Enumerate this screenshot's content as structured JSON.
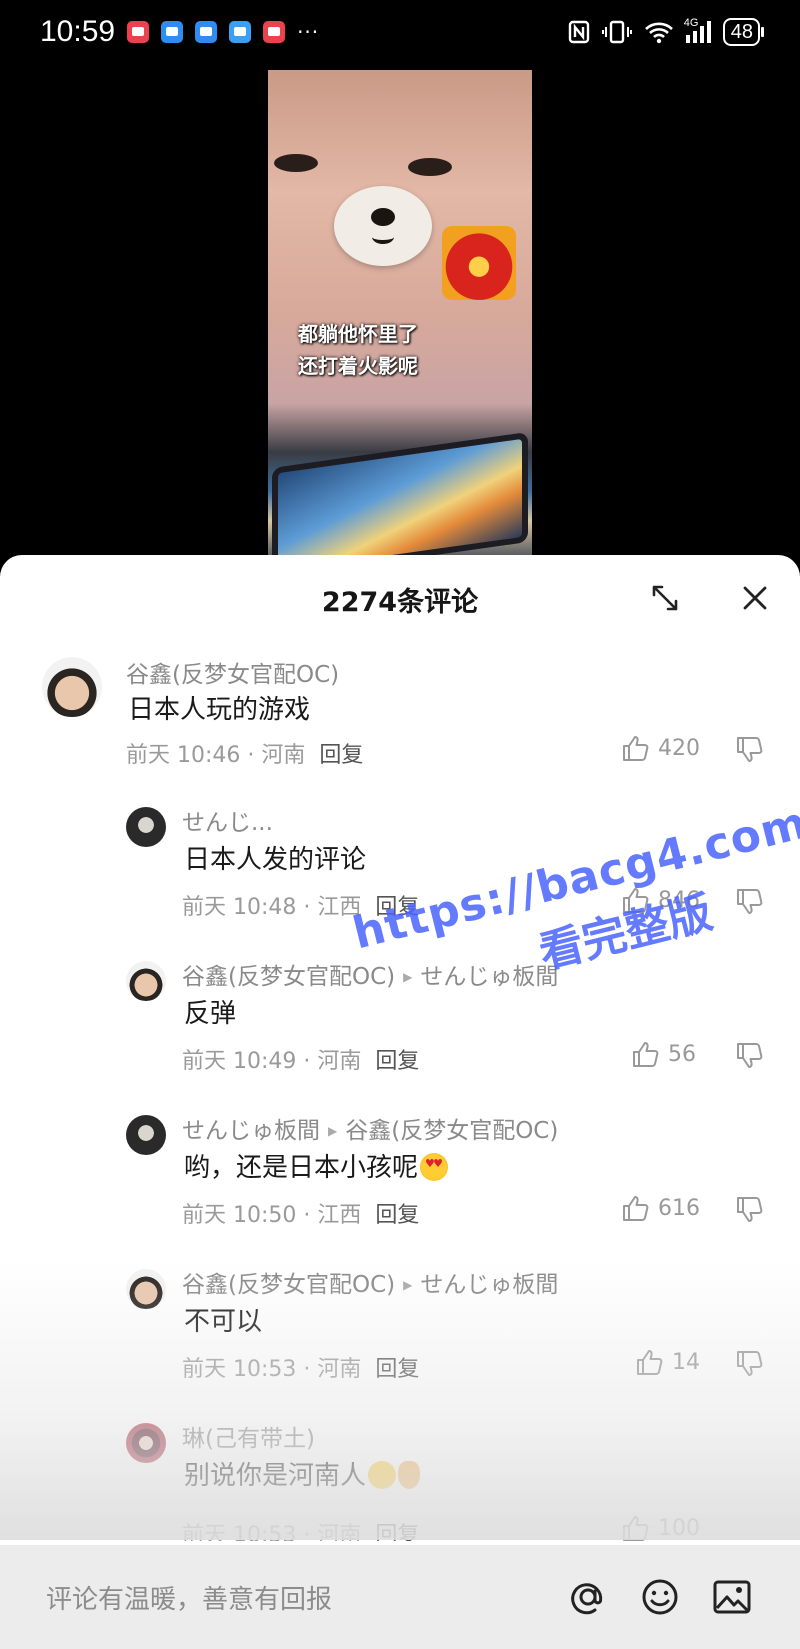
{
  "status_bar": {
    "time": "10:59",
    "notification_more": "···",
    "signal_label": "4G",
    "battery": "48",
    "notification_colors": [
      "#e8434f",
      "#2f8cf1",
      "#2f8cf1",
      "#3aa0f5",
      "#e8434f"
    ]
  },
  "video": {
    "caption_line1": "都躺他怀里了",
    "caption_line2": "还打着火影呢"
  },
  "comments_panel": {
    "title": "2274条评论",
    "comments": [
      {
        "author": "谷鑫(反梦女官配OC)",
        "reply_to": "",
        "text": "日本人玩的游戏",
        "time": "前天 10:46",
        "location": "河南",
        "reply_label": "回复",
        "likes": "420"
      },
      {
        "author": "せんじ...",
        "reply_to": "",
        "text": "日本人发的评论",
        "time": "前天 10:48",
        "location": "江西",
        "reply_label": "回复",
        "likes": "846"
      },
      {
        "author": "谷鑫(反梦女官配OC)",
        "reply_to": "せんじゅ板間",
        "text": "反弹",
        "time": "前天 10:49",
        "location": "河南",
        "reply_label": "回复",
        "likes": "56"
      },
      {
        "author": "せんじゅ板間",
        "reply_to": "谷鑫(反梦女官配OC)",
        "text": "哟，还是日本小孩呢",
        "emoji": "heart-eyes-emoji",
        "time": "前天 10:50",
        "location": "江西",
        "reply_label": "回复",
        "likes": "616"
      },
      {
        "author": "谷鑫(反梦女官配OC)",
        "reply_to": "せんじゅ板間",
        "text": "不可以",
        "time": "前天 10:53",
        "location": "河南",
        "reply_label": "回复",
        "likes": "14"
      },
      {
        "author": "琳(己有带土)",
        "reply_to": "",
        "text": "别说你是河南人",
        "emoji": "laughing-emoji ok-hand-emoji",
        "time": "前天 10:53",
        "location": "河南",
        "reply_label": "回复",
        "likes": "100"
      }
    ]
  },
  "watermark": {
    "url": "https://bacg4.com",
    "subtitle": "看完整版"
  },
  "input": {
    "placeholder": "评论有温暖，善意有回报",
    "icons": [
      "at-icon",
      "emoji-icon",
      "image-icon"
    ]
  },
  "colors": {
    "watermark": "#4a63ff",
    "secondary_text": "#8a8a8a",
    "input_bar": "#ececec"
  }
}
